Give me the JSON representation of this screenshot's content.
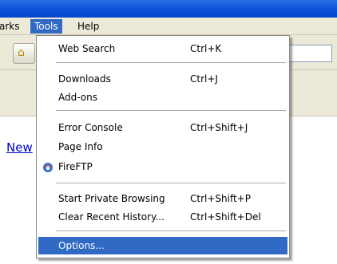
{
  "menubar": {
    "items": [
      {
        "label": "arks"
      },
      {
        "label": "Tools"
      },
      {
        "label": "Help"
      }
    ]
  },
  "content": {
    "link_text": "New"
  },
  "tools_menu": {
    "items": [
      {
        "label": "Web Search",
        "shortcut": "Ctrl+K"
      },
      {
        "label": "Downloads",
        "shortcut": "Ctrl+J"
      },
      {
        "label": "Add-ons",
        "shortcut": ""
      },
      {
        "label": "Error Console",
        "shortcut": "Ctrl+Shift+J"
      },
      {
        "label": "Page Info",
        "shortcut": ""
      },
      {
        "label": "FireFTP",
        "shortcut": "",
        "icon": "fireftp-icon"
      },
      {
        "label": "Start Private Browsing",
        "shortcut": "Ctrl+Shift+P"
      },
      {
        "label": "Clear Recent History...",
        "shortcut": "Ctrl+Shift+Del"
      },
      {
        "label": "Options...",
        "shortcut": "",
        "selected": true
      }
    ]
  },
  "colors": {
    "menu_highlight": "#316ac5",
    "titlebar": "#0a52d8",
    "chrome_background": "#ece9d8"
  }
}
